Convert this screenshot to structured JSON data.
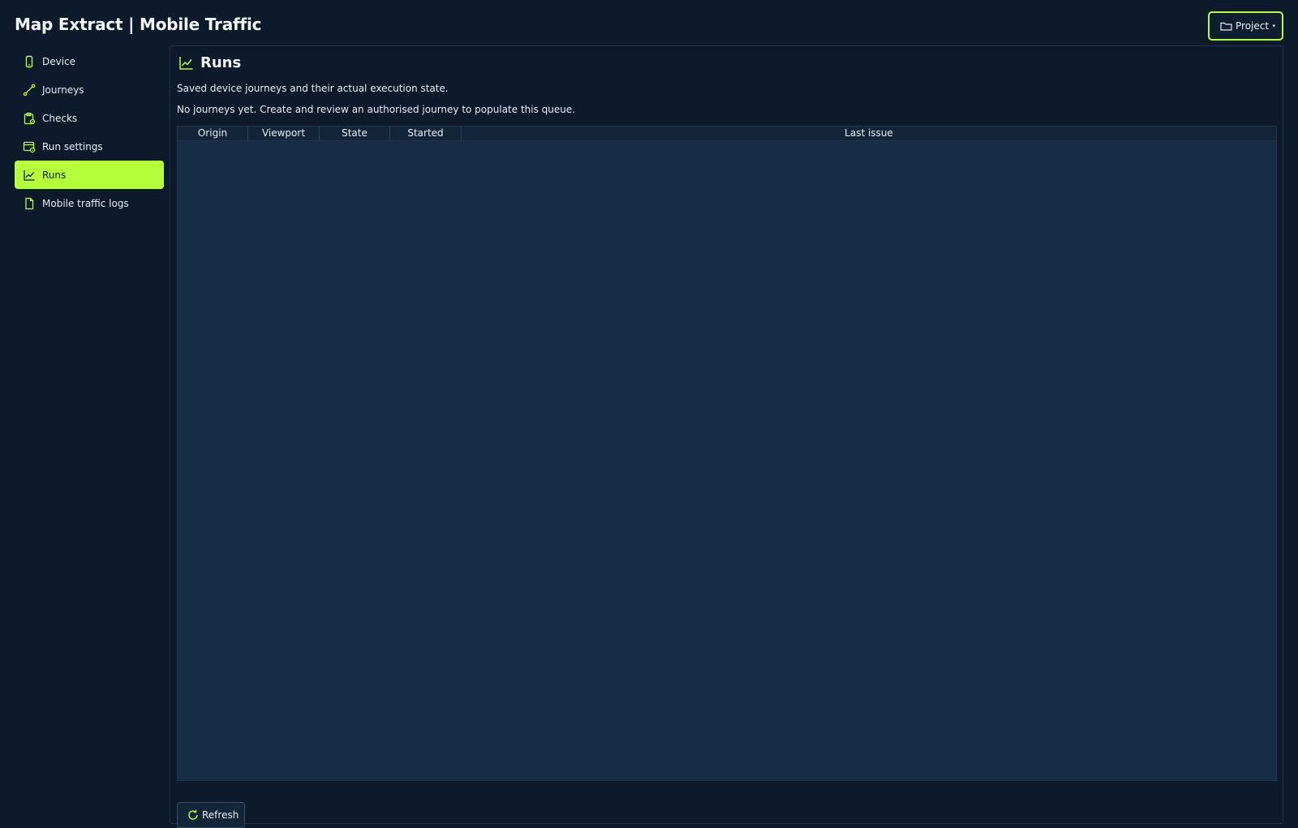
{
  "app": {
    "title": "Map Extract | Mobile Traffic"
  },
  "header": {
    "project_label": "Project",
    "project_icon": "folder-icon",
    "caret": "▾"
  },
  "colors": {
    "accent": "#b6ff3b",
    "background": "#0c1a2c",
    "table_bg": "#172c45"
  },
  "sidebar": {
    "items": [
      {
        "label": "Device",
        "icon": "phone-icon"
      },
      {
        "label": "Journeys",
        "icon": "route-icon"
      },
      {
        "label": "Checks",
        "icon": "clipboard-check-icon"
      },
      {
        "label": "Run settings",
        "icon": "settings-window-icon"
      },
      {
        "label": "Runs",
        "icon": "line-chart-icon",
        "active": true
      },
      {
        "label": "Mobile traffic logs",
        "icon": "file-icon"
      }
    ]
  },
  "main": {
    "title": "Runs",
    "title_icon": "line-chart-icon",
    "description": "Saved device journeys and their actual execution state.",
    "empty_message": "No journeys yet. Create and review an authorised journey to populate this queue.",
    "table": {
      "columns": [
        "Origin",
        "Viewport",
        "State",
        "Started",
        "Last issue"
      ],
      "rows": []
    },
    "refresh_label": "Refresh",
    "refresh_icon": "refresh-icon"
  }
}
